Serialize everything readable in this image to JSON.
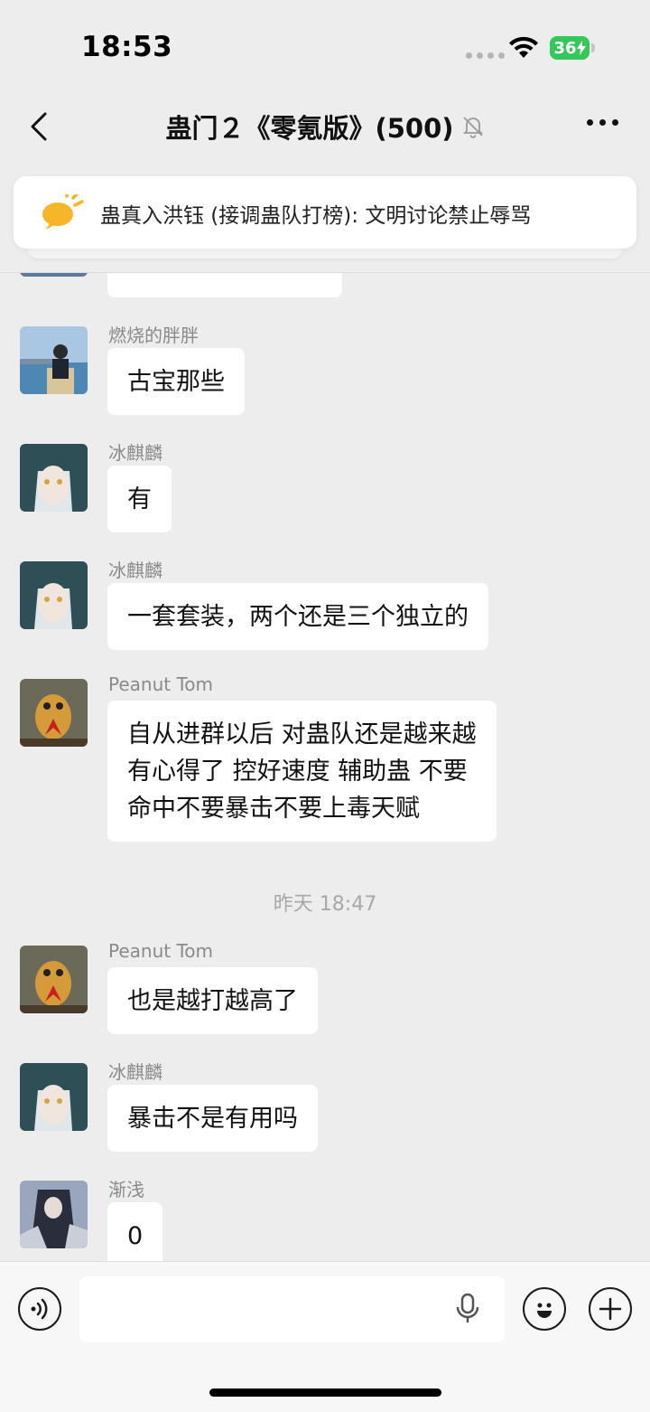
{
  "status_bar": {
    "time": "18:53",
    "battery": "36"
  },
  "header": {
    "title": "蛊门２《零氪版》(500)",
    "muted": true
  },
  "notice": {
    "text": "蛊真入洪钰 (接调蛊队打榜): 文明讨论禁止辱骂"
  },
  "messages": [
    {
      "sender": "",
      "text": "",
      "partial": true
    },
    {
      "sender": "燃烧的胖胖",
      "text": "古宝那些"
    },
    {
      "sender": "冰麒麟",
      "text": "有"
    },
    {
      "sender": "冰麒麟",
      "text": "一套套装，两个还是三个独立的"
    },
    {
      "sender": "Peanut Tom",
      "lines": [
        "自从进群以后 对蛊队还是越来越",
        "有心得了  控好速度  辅助蛊 不要",
        "命中不要暴击不要上毒天赋"
      ]
    },
    {
      "sender": "Peanut Tom",
      "text": "也是越打越高了"
    },
    {
      "sender": "冰麒麟",
      "text": "暴击不是有用吗"
    },
    {
      "sender": "渐浅",
      "text": "0"
    }
  ],
  "timestamp": "昨天 18:47",
  "input": {
    "value": "",
    "placeholder": ""
  },
  "colors": {
    "background": "#ededed",
    "bubble": "#ffffff",
    "battery": "#34c759",
    "notice_icon": "#f7b62a"
  }
}
